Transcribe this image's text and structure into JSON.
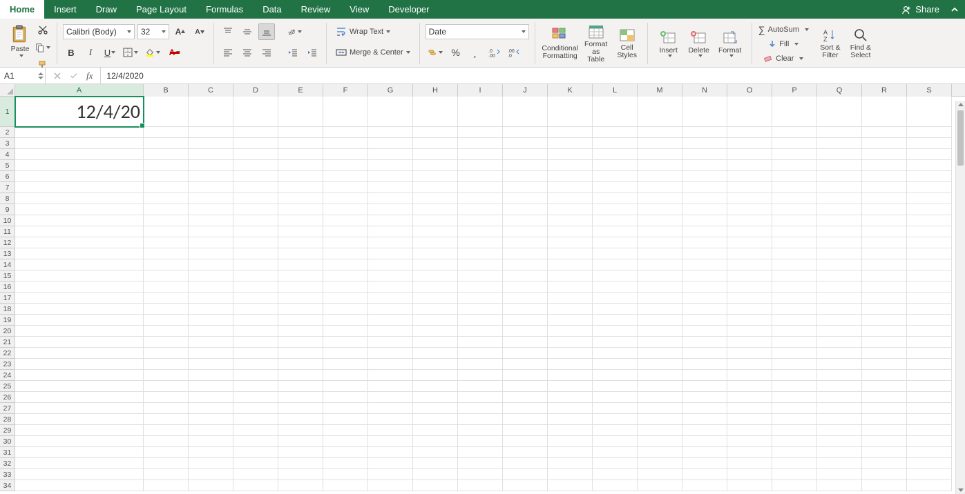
{
  "tabs": {
    "items": [
      "Home",
      "Insert",
      "Draw",
      "Page Layout",
      "Formulas",
      "Data",
      "Review",
      "View",
      "Developer"
    ],
    "active": 0,
    "share": "Share"
  },
  "ribbon": {
    "paste": "Paste",
    "font_name": "Calibri (Body)",
    "font_size": "32",
    "wrap": "Wrap Text",
    "merge": "Merge & Center",
    "number_format": "Date",
    "cond_fmt": "Conditional Formatting",
    "fmt_table": "Format as Table",
    "cell_styles": "Cell Styles",
    "insert": "Insert",
    "delete": "Delete",
    "format": "Format",
    "autosum": "AutoSum",
    "fill": "Fill",
    "clear": "Clear",
    "sort": "Sort & Filter",
    "find": "Find & Select"
  },
  "formula_bar": {
    "name_box": "A1",
    "formula": "12/4/2020"
  },
  "grid": {
    "columns": [
      "A",
      "B",
      "C",
      "D",
      "E",
      "F",
      "G",
      "H",
      "I",
      "J",
      "K",
      "L",
      "M",
      "N",
      "O",
      "P",
      "Q",
      "R",
      "S"
    ],
    "col_widths": {
      "A": 186,
      "default": 65
    },
    "rows": 34,
    "row_heights": {
      "1": 44,
      "default": 16
    },
    "selected_cell": {
      "row": 1,
      "col": "A"
    },
    "cells": {
      "A1": "12/4/20"
    }
  }
}
